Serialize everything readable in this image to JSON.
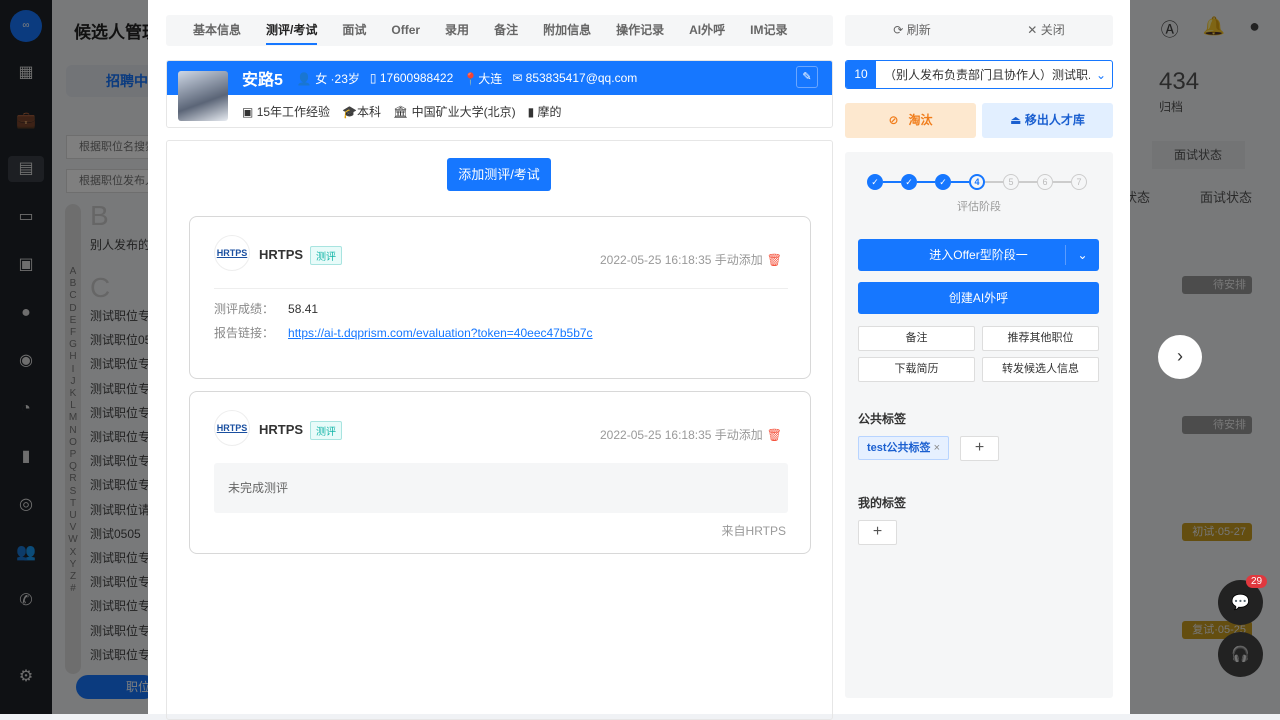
{
  "background": {
    "page_title": "候选人管理",
    "recruit_tab": "招聘中",
    "search_placeholder_1": "根据职位名搜索",
    "search_placeholder_2": "根据职位发布人",
    "letters": [
      "A",
      "B",
      "C",
      "D",
      "E",
      "F",
      "G",
      "H",
      "I",
      "J",
      "K",
      "L",
      "M",
      "N",
      "O",
      "P",
      "Q",
      "R",
      "S",
      "T",
      "U",
      "V",
      "W",
      "X",
      "Y",
      "Z",
      "#"
    ],
    "group_b": "B",
    "group_b_item": "别人发布的",
    "group_c": "C",
    "jobs": [
      "测试职位专",
      "测试职位05",
      "测试职位专",
      "测试职位专",
      "测试职位专",
      "测试职位专",
      "测试职位专",
      "测试职位专",
      "测试职位请",
      "测试0505",
      "测试职位专",
      "测试职位专",
      "测试职位专",
      "测试职位专",
      "测试职位专"
    ],
    "bottom_tab": "职位",
    "archived_count": "434",
    "archived_label": "归档",
    "filter_interview": "面试状态",
    "col_status": "状态",
    "col_interview": "面试状态",
    "chips": [
      "待安排",
      "待安排",
      "初试·05-27",
      "复试·05-25"
    ],
    "chat_badge": "29"
  },
  "tabs": [
    "基本信息",
    "测评/考试",
    "面试",
    "Offer",
    "录用",
    "备注",
    "附加信息",
    "操作记录",
    "AI外呼",
    "IM记录"
  ],
  "active_tab": 1,
  "actions": {
    "refresh": "刷新",
    "close": "关闭"
  },
  "candidate": {
    "name": "安路5",
    "gender_age": "女 ·23岁",
    "phone": "17600988422",
    "city": "大连",
    "email": "853835417@qq.com",
    "experience": "15年工作经验",
    "degree": "本科",
    "school": "中国矿业大学(北京)",
    "major": "摩的"
  },
  "assessment": {
    "add_button": "添加测评/考试",
    "cards": [
      {
        "vendor": "HRTPS",
        "badge": "测评",
        "time": "2022-05-25 16:18:35 手动添加",
        "score_label": "测评成绩：",
        "score": "58.41",
        "link_label": "报告链接：",
        "link": "https://ai-t.dqprism.com/evaluation?token=40eec47b5b7c"
      },
      {
        "vendor": "HRTPS",
        "badge": "测评",
        "time": "2022-05-25 16:18:35 手动添加",
        "status": "未完成测评",
        "source": "来自HRTPS"
      }
    ]
  },
  "right": {
    "job_index": "10",
    "job_name": "（别人发布负责部门且协作人）测试职...",
    "reject": "淘汰",
    "remove_pool": "移出人才库",
    "steps": [
      "1",
      "2",
      "3",
      "4",
      "5",
      "6",
      "7"
    ],
    "current_step": 4,
    "step_label": "评估阶段",
    "enter_offer": "进入Offer型阶段一",
    "create_ai_call": "创建AI外呼",
    "note": "备注",
    "recommend": "推荐其他职位",
    "download": "下载简历",
    "forward": "转发候选人信息",
    "public_tags_title": "公共标签",
    "public_tags": [
      "test公共标签"
    ],
    "my_tags_title": "我的标签"
  },
  "colors": {
    "primary": "#1677ff",
    "reject_bg": "#fde8cf",
    "reject_fg": "#f07c1a",
    "remove_bg": "#e2efff"
  }
}
